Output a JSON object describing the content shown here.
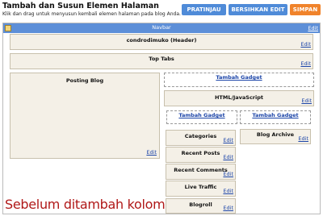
{
  "header": {
    "title": "Tambah dan Susun Elemen Halaman",
    "subtitle": "Klik dan drag untuk menyusun kembali elemen halaman pada blog Anda."
  },
  "toolbar": {
    "preview_label": "PRATINJAU",
    "clear_label": "BERSIHKAN EDIT",
    "save_label": "SIMPAN"
  },
  "layout": {
    "navbar": {
      "label": "Navbar",
      "edit": "Edit"
    },
    "header_widget": {
      "label": "condrodimuko (Header)",
      "edit": "Edit"
    },
    "tabs_widget": {
      "label": "Top Tabs",
      "edit": "Edit"
    },
    "main": {
      "label": "Posting Blog",
      "edit": "Edit"
    },
    "sidebar": {
      "add_gadget": "Tambah Gadget",
      "html_widget": {
        "label": "HTML/JavaScript",
        "edit": "Edit"
      },
      "left_column": {
        "add_gadget": "Tambah Gadget",
        "widgets": [
          {
            "label": "Categories",
            "edit": "Edit"
          },
          {
            "label": "Recent Posts",
            "edit": "Edit"
          },
          {
            "label": "Recent Comments",
            "edit": "Edit"
          },
          {
            "label": "Live Traffic",
            "edit": "Edit"
          },
          {
            "label": "Blogroll",
            "edit": "Edit"
          }
        ]
      },
      "right_column": {
        "add_gadget": "Tambah Gadget",
        "widgets": [
          {
            "label": "Blog Archive",
            "edit": "Edit"
          }
        ]
      }
    }
  },
  "caption": "Sebelum ditambah kolom",
  "colors": {
    "accent_blue": "#4f8bd8",
    "save_orange": "#f0832b",
    "navbar_blue": "#5d8fd8",
    "widget_bg": "#f4f0e7",
    "link_blue": "#1c45a8",
    "caption_red": "#b01818"
  }
}
